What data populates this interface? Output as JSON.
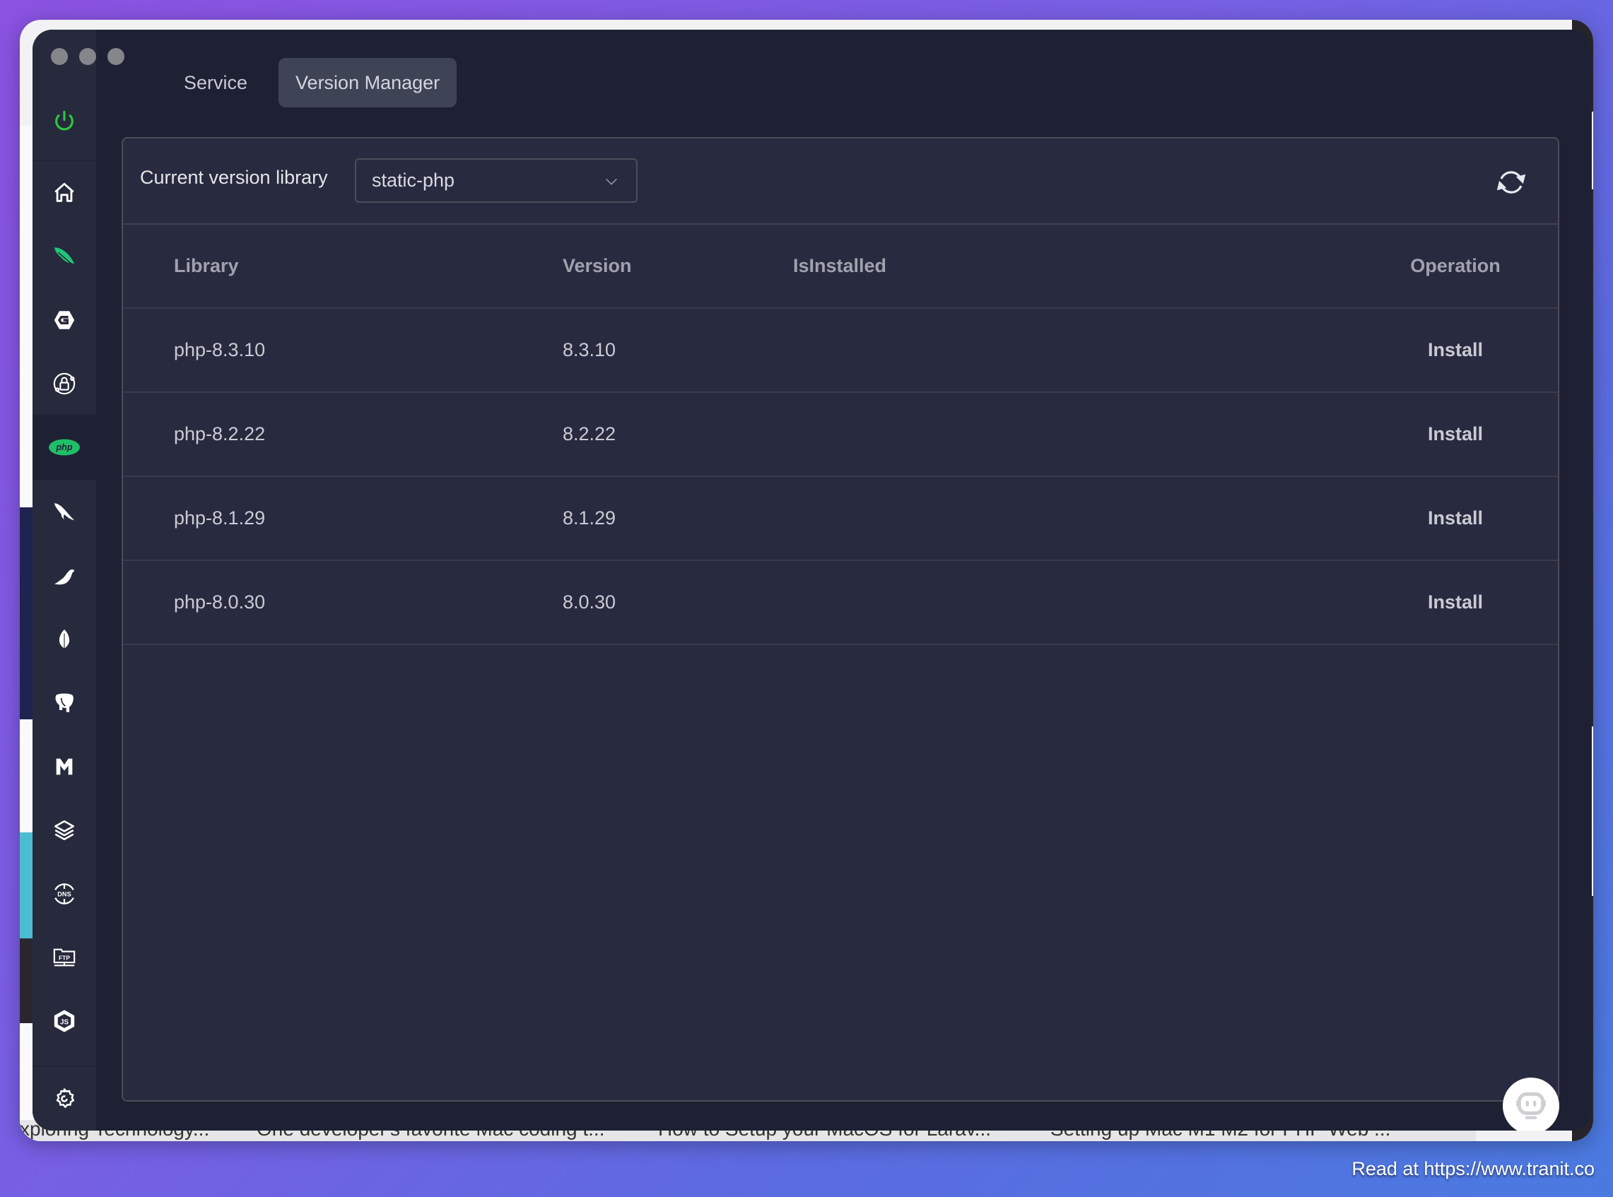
{
  "window": {
    "traffic_lights": [
      "close",
      "minimize",
      "zoom"
    ]
  },
  "sidebar": {
    "items": [
      {
        "id": "power",
        "icon": "power-icon",
        "color": "#2ec840",
        "active": false
      },
      {
        "id": "home",
        "icon": "home-icon",
        "active": false
      },
      {
        "id": "feather",
        "icon": "feather-icon",
        "color": "#22c47a",
        "active": false
      },
      {
        "id": "g-hexagon",
        "icon": "g-hexagon-icon",
        "active": false
      },
      {
        "id": "ssl",
        "icon": "lock-network-icon",
        "active": false
      },
      {
        "id": "php",
        "icon": "php-icon",
        "label": "php",
        "color": "#1fbf6a",
        "active": true
      },
      {
        "id": "mysql",
        "icon": "dolphin-icon",
        "active": false
      },
      {
        "id": "mariadb",
        "icon": "seal-icon",
        "active": false
      },
      {
        "id": "mongodb",
        "icon": "leaf-icon",
        "active": false
      },
      {
        "id": "postgresql",
        "icon": "elephant-icon",
        "active": false
      },
      {
        "id": "memcached",
        "icon": "m-icon",
        "active": false
      },
      {
        "id": "redis",
        "icon": "layers-icon",
        "active": false
      },
      {
        "id": "dns",
        "icon": "dns-icon",
        "label": "DNS",
        "active": false
      },
      {
        "id": "ftp",
        "icon": "ftp-icon",
        "label": "FTP",
        "active": false
      },
      {
        "id": "nodejs",
        "icon": "nodejs-icon",
        "label": "JS",
        "active": false
      },
      {
        "id": "settings",
        "icon": "gear-icon",
        "active": false
      }
    ]
  },
  "tabs": [
    {
      "label": "Service",
      "active": false
    },
    {
      "label": "Version Manager",
      "active": true
    }
  ],
  "toolbar": {
    "label": "Current version library",
    "select_value": "static-php",
    "refresh_icon": "refresh-icon"
  },
  "table": {
    "columns": [
      "Library",
      "Version",
      "IsInstalled",
      "Operation"
    ],
    "rows": [
      {
        "library": "php-8.3.10",
        "version": "8.3.10",
        "installed": "",
        "operation": "Install"
      },
      {
        "library": "php-8.2.22",
        "version": "8.2.22",
        "installed": "",
        "operation": "Install"
      },
      {
        "library": "php-8.1.29",
        "version": "8.1.29",
        "installed": "",
        "operation": "Install"
      },
      {
        "library": "php-8.0.30",
        "version": "8.0.30",
        "installed": "",
        "operation": "Install"
      }
    ]
  },
  "assistant_button": {
    "icon": "robot-icon"
  },
  "background_page": {
    "bottom_links": [
      "xploring Technology...",
      "One developer's favorite Mac coding t...",
      "How to Setup your MacOS for Larav...",
      "Setting up Mac M1 M2 for PHP Web ..."
    ]
  },
  "watermark": "Read at https://www.tranit.co",
  "colors": {
    "accent_link": "#3d94e6",
    "power_green": "#2ec840",
    "php_green": "#1fbf6a",
    "window_bg": "#1e2134",
    "card_bg": "#282b3f",
    "sidebar_bg": "#272a3c"
  }
}
